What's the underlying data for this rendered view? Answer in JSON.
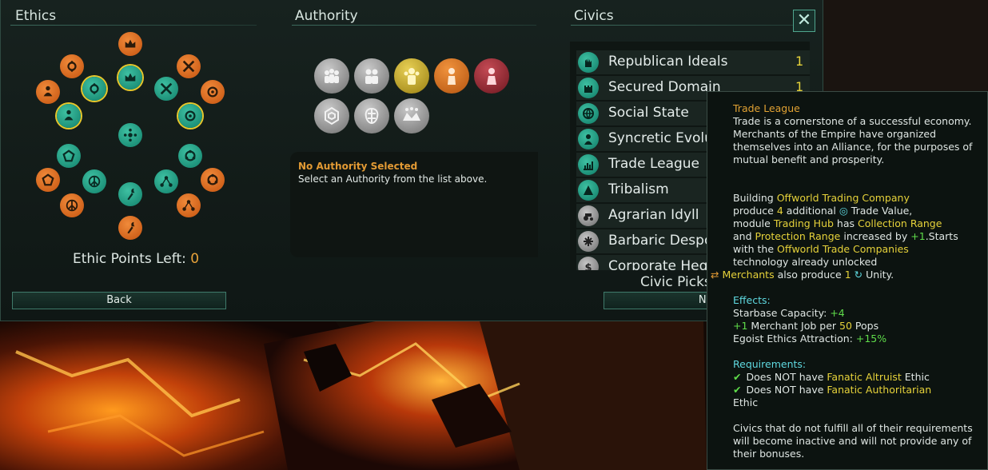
{
  "ethics": {
    "title": "Ethics",
    "points_label": "Ethic Points Left:",
    "points_value": "0",
    "icons": [
      {
        "name": "authoritarian",
        "color": "orange",
        "selected": false
      },
      {
        "name": "fanatic-authoritarian",
        "color": "teal",
        "selected": true
      },
      {
        "name": "egalitarian",
        "color": "orange",
        "selected": false
      },
      {
        "name": "fanatic-egalitarian",
        "color": "teal",
        "selected": true
      },
      {
        "name": "militarist",
        "color": "orange",
        "selected": false
      },
      {
        "name": "fanatic-militarist",
        "color": "teal",
        "selected": false
      },
      {
        "name": "pacifist",
        "color": "orange",
        "selected": false
      },
      {
        "name": "fanatic-pacifist",
        "color": "teal",
        "selected": false
      },
      {
        "name": "spiritualist",
        "color": "orange",
        "selected": false
      },
      {
        "name": "fanatic-spiritualist",
        "color": "teal",
        "selected": true
      },
      {
        "name": "materialist",
        "color": "orange",
        "selected": false
      },
      {
        "name": "fanatic-materialist",
        "color": "teal",
        "selected": false
      },
      {
        "name": "xenophile",
        "color": "orange",
        "selected": false
      },
      {
        "name": "fanatic-xenophile",
        "color": "teal",
        "selected": false
      },
      {
        "name": "xenophobe",
        "color": "orange",
        "selected": false
      },
      {
        "name": "fanatic-xenophobe",
        "color": "teal",
        "selected": false
      },
      {
        "name": "gestalt",
        "color": "teal",
        "selected": false
      },
      {
        "name": "egoist",
        "color": "orange",
        "selected": false
      },
      {
        "name": "fanatic-egoist",
        "color": "teal",
        "selected": false
      }
    ]
  },
  "authority": {
    "title": "Authority",
    "none_selected_title": "No Authority Selected",
    "none_selected_desc": "Select an Authority from the list above.",
    "icons": [
      "democratic",
      "oligarchic",
      "dictatorial",
      "imperial",
      "corporate",
      "hive-mind",
      "machine-intelligence",
      "corporate-dominion"
    ]
  },
  "civics": {
    "title": "Civics",
    "picks_label": "Civic Picks Left:",
    "items": [
      {
        "label": "Republican Ideals",
        "cost": "1",
        "style": "teal"
      },
      {
        "label": "Secured Domain",
        "cost": "1",
        "style": "teal"
      },
      {
        "label": "Social State",
        "cost": "",
        "style": "teal"
      },
      {
        "label": "Syncretic Evolution",
        "cost": "",
        "style": "teal"
      },
      {
        "label": "Trade League",
        "cost": "",
        "style": "teal"
      },
      {
        "label": "Tribalism",
        "cost": "",
        "style": "teal"
      },
      {
        "label": "Agrarian Idyll",
        "cost": "",
        "style": "grey"
      },
      {
        "label": "Barbaric Despoilers",
        "cost": "",
        "style": "grey"
      },
      {
        "label": "Corporate Hegemony",
        "cost": "",
        "style": "grey"
      }
    ]
  },
  "buttons": {
    "back": "Back",
    "next": "Next",
    "close": "✕"
  },
  "tooltip": {
    "title": "Trade League",
    "description": "Trade is a cornerstone of a successful economy. Merchants of the Empire have organized  themselves into an Alliance, for the purposes of mutual benefit and prosperity.",
    "building_pre": "Building",
    "building_name": "Offworld Trading Company",
    "produce_pre": "produce",
    "produce_num": "4",
    "produce_post": "additional",
    "trade_value": "Trade Value,",
    "module_pre": "module",
    "module_name": "Trading Hub",
    "has": "has",
    "collection_range": "Collection Range",
    "and": "and",
    "protection_range": "Protection Range",
    "increased_by": "increased by",
    "plus_one": "+1",
    "starts_with": ".Starts with the",
    "tech_name": "Offworld Trade Companies",
    "tech_post": "technology already unlocked",
    "merchants": "Merchants",
    "also_produce": "also produce",
    "merch_num": "1",
    "unity": "Unity.",
    "effects_title": "Effects:",
    "eff1_label": "Starbase Capacity:",
    "eff1_val": "+4",
    "eff2_val": "+1",
    "eff2_mid": "Merchant Job per",
    "eff2_num": "50",
    "eff2_post": "Pops",
    "eff3_label": "Egoist Ethics Attraction:",
    "eff3_val": "+15%",
    "req_title": "Requirements:",
    "req1_pre": "Does NOT have",
    "req1_name": "Fanatic Altruist",
    "req1_post": "Ethic",
    "req2_pre": "Does NOT have",
    "req2_name": "Fanatic Authoritarian",
    "req2_post": "Ethic",
    "footer": "Civics that do not fulfill all of their requirements will become inactive and will not provide any of their bonuses."
  },
  "colors": {
    "highlight_yellow": "#e6d23a",
    "positive_green": "#5fdc4a",
    "header_orange": "#e29a34",
    "teal_icon": "#17a085",
    "orange_icon": "#d9641a"
  }
}
